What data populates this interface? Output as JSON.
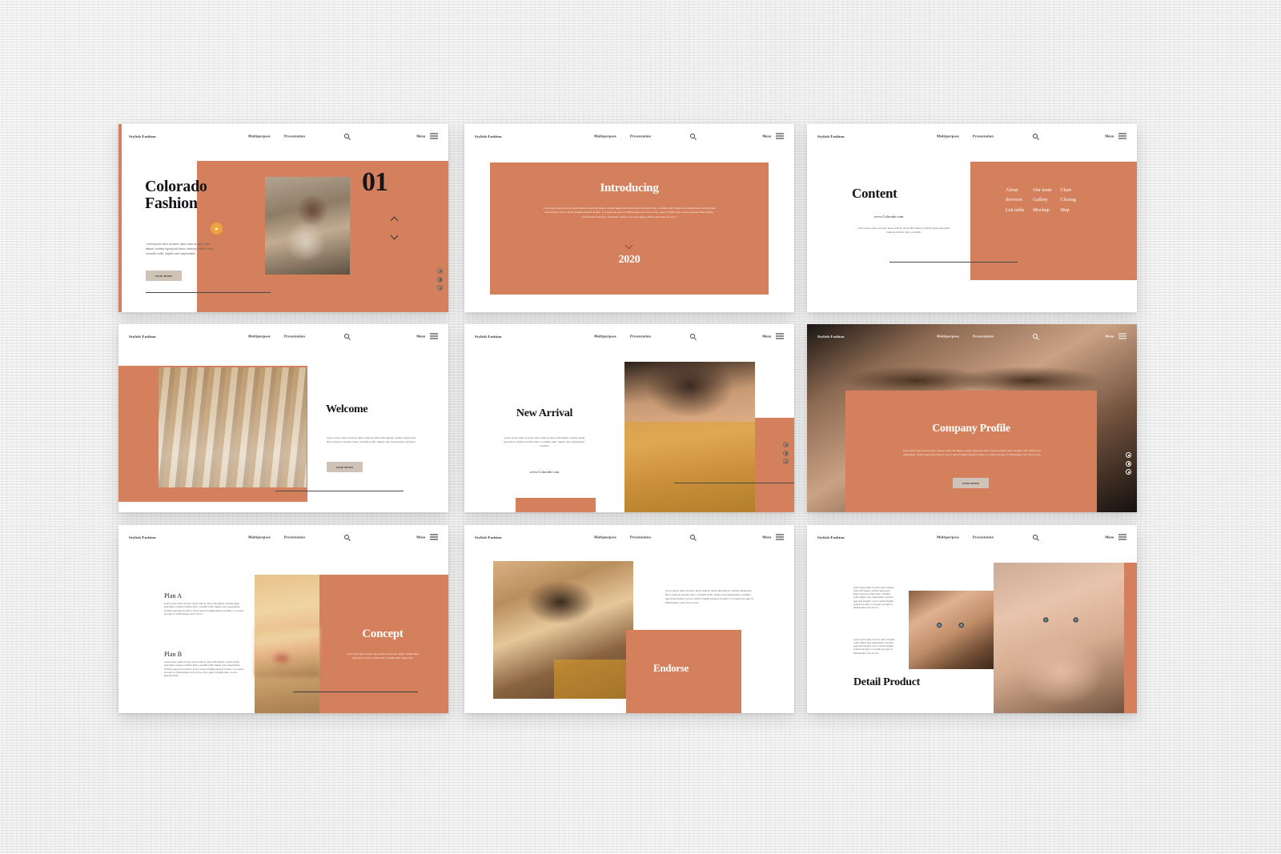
{
  "meta": {
    "accent_orange": "#d4805c",
    "accent_orange_soft": "#dd9271",
    "button_beige": "#cfc2b6",
    "mustard": "#e0a028",
    "play_orange": "#f0a23c",
    "ink": "#16161a"
  },
  "nav": {
    "brand": "Stylish Fashion",
    "links": [
      "Multipurpose",
      "Presentation"
    ],
    "search_icon": "search-icon",
    "menu_label": "Menu",
    "menu_icon": "hamburger-icon"
  },
  "common": {
    "view_more": "VIEW MORE",
    "url": "www.Colorado.com",
    "social": [
      "twitter-icon",
      "instagram-icon",
      "pinterest-icon"
    ]
  },
  "slides": [
    {
      "id": "cover",
      "number": "01",
      "title_line1": "Colorado",
      "title_line2": "Fashion",
      "body": "Lorem ipsum dolor sit amet, lacus nulla ac netus nibh aliquet, porttitor ligula justo libero vivamus porttitor dolor, convallis mollit. Sapien nam suspendisse.",
      "button": "VIEW MORE",
      "play_icon": "play-button-icon",
      "up_icon": "chevron-up-icon",
      "down_icon": "chevron-down-icon",
      "photo": "woman-with-glasses-photo"
    },
    {
      "id": "introducing",
      "title": "Introducing",
      "body": "Lorem ipsum dolor sit amet, lacus nulla ac netus nibh aliquet, porttitor ligula justo libero vivamus porttitor dolor, convallis mollit. Sapien nam suspendisse, tincidunt eget ante tincidunt, eros in auctor fringilla praesent sit diam. In ut quam est eget mi. Pellentesque nunc orci eu enim, eget in fringilla vitae, et eros praesent dolor porttitor. Lacinia lectus nonummy, accumsan mauris in est justo magnis, dictum justo lorem ac quis. A",
      "year": "2020",
      "down_icon": "chevron-down-icon"
    },
    {
      "id": "content",
      "title": "Content",
      "url": "www.Colorado.com",
      "body": "Lorem ipsum dolor sit amet, lacus nulla ac netus nibh aliquet, porttitor ligula justo libero vivamus porttitor dolor, convallis.",
      "columns": [
        [
          "About",
          "Services",
          "List table"
        ],
        [
          "Our team",
          "Gallery",
          "Mockup"
        ],
        [
          "Chart",
          "Closing",
          "Map"
        ]
      ]
    },
    {
      "id": "welcome",
      "title": "Welcome",
      "body": "Lorem ipsum dolor sit amet, lacus nulla ac netus nibh aliquet, porttitor ligula justo libero vivamus porttitor dolor, convallis mollit. Sapien nam suspendisse, tincidunt",
      "button": "VIEW MORE",
      "photo": "woman-in-atelier-photo"
    },
    {
      "id": "new-arrival",
      "title": "New Arrival",
      "body": "Lorem ipsum dolor sit amet, lacus nulla ac netus nibh aliquet, porttitor ligula justo libero vivamus porttitor dolor, convallis mollit. Sapien nam suspendisse, tincidunt",
      "url": "www.Colorado.com",
      "photo": "necklace-portrait-photo"
    },
    {
      "id": "company-profile",
      "title": "Company Profile",
      "body": "Lorem ipsum dolor sit amet, lacus nulla ac netus nibh aliquet, porttitor ligula justo libero vivamus porttitor dolor, convallis mollit. Sapien nam suspendisse, tincidunt eget ante tincidunt, eros in auctor fringilla praesent sit diam. In ut quam est eget mi. Pellentesque nunc orci eu enim.",
      "button": "VIEW MORE",
      "photo": "close-up-eyes-photo"
    },
    {
      "id": "concept",
      "title": "Concept",
      "plan_a_title": "Plan A",
      "plan_a_body": "Lorem ipsum dolor sit amet, lacus nulla ac netus nibh aliquet, porttitor ligula justo libero vivamus porttitor dolor, convallis mollit. Sapien nam suspendisse, tincidunt eget ante tincidunt, eros in auctor fringilla praesent sit diam. In ut quam est eget mi. Pellentesque nunc orci eu",
      "plan_b_title": "Plan B",
      "plan_b_body": "Lorem ipsum dolor sit amet, lacus nulla ac netus nibh aliquet, porttitor ligula justo libero vivamus porttitor dolor, convallis mollit. Sapien nam suspendisse, tincidunt eget ante tincidunt, eros in auctor fringilla praesent sit diam. In ut quam est eget mi. Pellentesque nunc orci eu enim, eget in fringilla vitae, et eros praesent dolor",
      "caption": "Lorem ipsum dolor sit amet, lacus nulla ac netus nibh aliquet, porttitor ligula justo libero vivamus porttitor dolor, convallis mollit. Sapien nam",
      "photo": "blonde-model-photo"
    },
    {
      "id": "endorse",
      "title": "Endorse",
      "body": "Lorem ipsum dolor sit amet, lacus nulla ac netus nibh aliquet, porttitor ligula justo libero vivamus porttitor dolor, convallis mollit. Sapien nam suspendisse, tincidunt eget ante tincidunt, eros in auctor fringilla praesent sit diam. In ut quam est eget mi. Pellentesque nunc orci eu enim.",
      "photo": "woman-shading-eyes-photo"
    },
    {
      "id": "detail-product",
      "title": "Detail Product",
      "body_1": "Lorem ipsum dolor sit amet, lacus nulla ac netus nibh aliquet, porttitor ligula justo libero vivamus porttitor dolor, convallis mollit. Sapien nam suspendisse, tincidunt eget ante tincidunt, eros in auctor fringilla praesent sit diam. In ut quam est eget mi. Pellentesque nunc orci eu",
      "body_2": "Lorem ipsum dolor sit amet, dolor convallis mollit. Sapien nam suspendisse, tincidunt eget ante tincidunt, eros in auctor fringilla praesent sit diam. In ut quam est eget mi. Pellentesque nunc orci eu",
      "photo_left": "model-face-shadow-photo",
      "photo_right": "model-portrait-hands-photo"
    }
  ]
}
